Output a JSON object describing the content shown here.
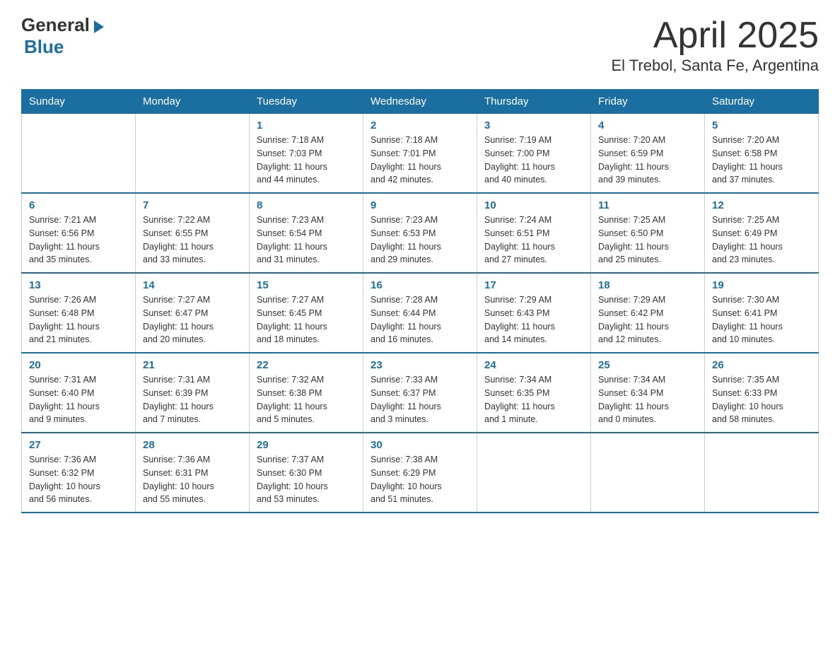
{
  "logo": {
    "general": "General",
    "blue": "Blue"
  },
  "title": "April 2025",
  "subtitle": "El Trebol, Santa Fe, Argentina",
  "days_of_week": [
    "Sunday",
    "Monday",
    "Tuesday",
    "Wednesday",
    "Thursday",
    "Friday",
    "Saturday"
  ],
  "weeks": [
    [
      {
        "day": "",
        "info": ""
      },
      {
        "day": "",
        "info": ""
      },
      {
        "day": "1",
        "info": "Sunrise: 7:18 AM\nSunset: 7:03 PM\nDaylight: 11 hours\nand 44 minutes."
      },
      {
        "day": "2",
        "info": "Sunrise: 7:18 AM\nSunset: 7:01 PM\nDaylight: 11 hours\nand 42 minutes."
      },
      {
        "day": "3",
        "info": "Sunrise: 7:19 AM\nSunset: 7:00 PM\nDaylight: 11 hours\nand 40 minutes."
      },
      {
        "day": "4",
        "info": "Sunrise: 7:20 AM\nSunset: 6:59 PM\nDaylight: 11 hours\nand 39 minutes."
      },
      {
        "day": "5",
        "info": "Sunrise: 7:20 AM\nSunset: 6:58 PM\nDaylight: 11 hours\nand 37 minutes."
      }
    ],
    [
      {
        "day": "6",
        "info": "Sunrise: 7:21 AM\nSunset: 6:56 PM\nDaylight: 11 hours\nand 35 minutes."
      },
      {
        "day": "7",
        "info": "Sunrise: 7:22 AM\nSunset: 6:55 PM\nDaylight: 11 hours\nand 33 minutes."
      },
      {
        "day": "8",
        "info": "Sunrise: 7:23 AM\nSunset: 6:54 PM\nDaylight: 11 hours\nand 31 minutes."
      },
      {
        "day": "9",
        "info": "Sunrise: 7:23 AM\nSunset: 6:53 PM\nDaylight: 11 hours\nand 29 minutes."
      },
      {
        "day": "10",
        "info": "Sunrise: 7:24 AM\nSunset: 6:51 PM\nDaylight: 11 hours\nand 27 minutes."
      },
      {
        "day": "11",
        "info": "Sunrise: 7:25 AM\nSunset: 6:50 PM\nDaylight: 11 hours\nand 25 minutes."
      },
      {
        "day": "12",
        "info": "Sunrise: 7:25 AM\nSunset: 6:49 PM\nDaylight: 11 hours\nand 23 minutes."
      }
    ],
    [
      {
        "day": "13",
        "info": "Sunrise: 7:26 AM\nSunset: 6:48 PM\nDaylight: 11 hours\nand 21 minutes."
      },
      {
        "day": "14",
        "info": "Sunrise: 7:27 AM\nSunset: 6:47 PM\nDaylight: 11 hours\nand 20 minutes."
      },
      {
        "day": "15",
        "info": "Sunrise: 7:27 AM\nSunset: 6:45 PM\nDaylight: 11 hours\nand 18 minutes."
      },
      {
        "day": "16",
        "info": "Sunrise: 7:28 AM\nSunset: 6:44 PM\nDaylight: 11 hours\nand 16 minutes."
      },
      {
        "day": "17",
        "info": "Sunrise: 7:29 AM\nSunset: 6:43 PM\nDaylight: 11 hours\nand 14 minutes."
      },
      {
        "day": "18",
        "info": "Sunrise: 7:29 AM\nSunset: 6:42 PM\nDaylight: 11 hours\nand 12 minutes."
      },
      {
        "day": "19",
        "info": "Sunrise: 7:30 AM\nSunset: 6:41 PM\nDaylight: 11 hours\nand 10 minutes."
      }
    ],
    [
      {
        "day": "20",
        "info": "Sunrise: 7:31 AM\nSunset: 6:40 PM\nDaylight: 11 hours\nand 9 minutes."
      },
      {
        "day": "21",
        "info": "Sunrise: 7:31 AM\nSunset: 6:39 PM\nDaylight: 11 hours\nand 7 minutes."
      },
      {
        "day": "22",
        "info": "Sunrise: 7:32 AM\nSunset: 6:38 PM\nDaylight: 11 hours\nand 5 minutes."
      },
      {
        "day": "23",
        "info": "Sunrise: 7:33 AM\nSunset: 6:37 PM\nDaylight: 11 hours\nand 3 minutes."
      },
      {
        "day": "24",
        "info": "Sunrise: 7:34 AM\nSunset: 6:35 PM\nDaylight: 11 hours\nand 1 minute."
      },
      {
        "day": "25",
        "info": "Sunrise: 7:34 AM\nSunset: 6:34 PM\nDaylight: 11 hours\nand 0 minutes."
      },
      {
        "day": "26",
        "info": "Sunrise: 7:35 AM\nSunset: 6:33 PM\nDaylight: 10 hours\nand 58 minutes."
      }
    ],
    [
      {
        "day": "27",
        "info": "Sunrise: 7:36 AM\nSunset: 6:32 PM\nDaylight: 10 hours\nand 56 minutes."
      },
      {
        "day": "28",
        "info": "Sunrise: 7:36 AM\nSunset: 6:31 PM\nDaylight: 10 hours\nand 55 minutes."
      },
      {
        "day": "29",
        "info": "Sunrise: 7:37 AM\nSunset: 6:30 PM\nDaylight: 10 hours\nand 53 minutes."
      },
      {
        "day": "30",
        "info": "Sunrise: 7:38 AM\nSunset: 6:29 PM\nDaylight: 10 hours\nand 51 minutes."
      },
      {
        "day": "",
        "info": ""
      },
      {
        "day": "",
        "info": ""
      },
      {
        "day": "",
        "info": ""
      }
    ]
  ]
}
